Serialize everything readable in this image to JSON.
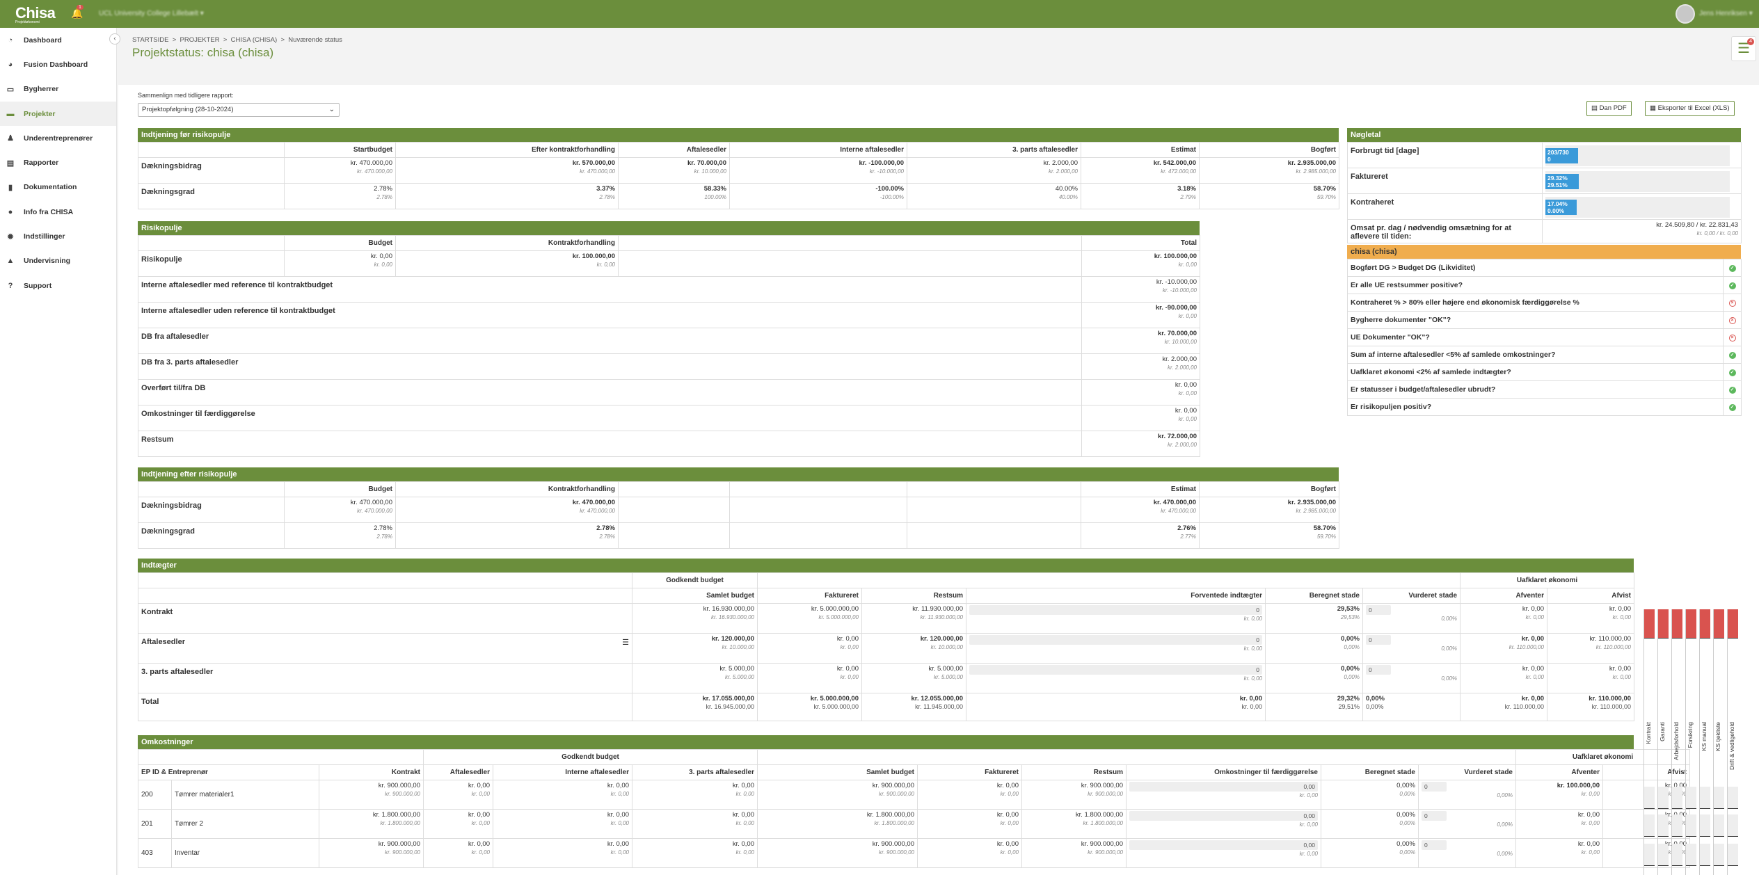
{
  "topbar": {
    "logo": "Chisa",
    "logo_sub": "Projektøkonomi",
    "bell_count": "1",
    "org_selector": "UCL University College Lillebælt ▾",
    "user_name": "Jens Henriksen ▾"
  },
  "sidebar": {
    "items": [
      {
        "label": "Dashboard",
        "icon": "speedometer-icon"
      },
      {
        "label": "Fusion Dashboard",
        "icon": "pie-icon"
      },
      {
        "label": "Bygherrer",
        "icon": "briefcase-icon"
      },
      {
        "label": "Projekter",
        "icon": "folder-icon",
        "active": true
      },
      {
        "label": "Underentreprenører",
        "icon": "user-icon"
      },
      {
        "label": "Rapporter",
        "icon": "document-icon"
      },
      {
        "label": "Dokumentation",
        "icon": "book-icon"
      },
      {
        "label": "Info fra CHISA",
        "icon": "info-icon"
      },
      {
        "label": "Indstillinger",
        "icon": "gear-icon"
      },
      {
        "label": "Undervisning",
        "icon": "graduation-icon"
      },
      {
        "label": "Support",
        "icon": "help-icon"
      }
    ]
  },
  "breadcrumb": {
    "items": [
      "STARTSIDE",
      "PROJEKTER",
      "CHISA (CHISA)",
      "Nuværende status"
    ]
  },
  "page_title": "Projektstatus: chisa (chisa)",
  "list_count": "4",
  "compare": {
    "label": "Sammenlign med tidligere rapport:",
    "selected": "Projektopfølgning (28-10-2024)"
  },
  "buttons": {
    "pdf": "Dan PDF",
    "excel": "Eksporter til Excel (XLS)"
  },
  "before": {
    "title": "Indtjening før risikopulje",
    "headers": [
      "",
      "Startbudget",
      "Efter kontraktforhandling",
      "Aftalesedler",
      "Interne aftalesedler",
      "3. parts aftalesedler",
      "Estimat",
      "Bogført"
    ],
    "rows": [
      {
        "label": "Dækningsbidrag",
        "cells": [
          [
            "kr. 470.000,00",
            "kr. 470.000,00"
          ],
          [
            "kr. 570.000,00",
            "kr. 470.000,00"
          ],
          [
            "kr. 70.000,00",
            "kr. 10.000,00"
          ],
          [
            "kr. -100.000,00",
            "kr. -10.000,00"
          ],
          [
            "kr. 2.000,00",
            "kr. 2.000,00"
          ],
          [
            "kr. 542.000,00",
            "kr. 472.000,00"
          ],
          [
            "kr. 2.935.000,00",
            "kr. 2.985.000,00"
          ]
        ]
      },
      {
        "label": "Dækningsgrad",
        "cells": [
          [
            "2.78%",
            "2.78%"
          ],
          [
            "3.37%",
            "2.78%"
          ],
          [
            "58.33%",
            "100.00%"
          ],
          [
            "-100.00%",
            "-100.00%"
          ],
          [
            "40.00%",
            "40.00%"
          ],
          [
            "3.18%",
            "2.79%"
          ],
          [
            "58.70%",
            "59.70%"
          ]
        ]
      }
    ]
  },
  "risk": {
    "title": "Risikopulje",
    "headers": [
      "",
      "Budget",
      "Kontraktforhandling",
      "",
      "Total"
    ],
    "first": {
      "label": "Risikopulje",
      "budget": [
        "kr. 0,00",
        "kr. 0,00"
      ],
      "kontrakt": [
        "kr. 100.000,00",
        "kr. 0,00"
      ],
      "total": [
        "kr. 100.000,00",
        "kr. 0,00"
      ]
    },
    "rows": [
      {
        "label": "Interne aftalesedler med reference til kontraktbudget",
        "total": [
          "kr. -10.000,00",
          "kr. -10.000,00"
        ]
      },
      {
        "label": "Interne aftalesedler uden reference til kontraktbudget",
        "total": [
          "kr. -90.000,00",
          "kr. 0,00"
        ]
      },
      {
        "label": "DB fra aftalesedler",
        "total": [
          "kr. 70.000,00",
          "kr. 10.000,00"
        ]
      },
      {
        "label": "DB fra 3. parts aftalesedler",
        "total": [
          "kr. 2.000,00",
          "kr. 2.000,00"
        ]
      },
      {
        "label": "Overført til/fra DB",
        "total": [
          "kr. 0,00",
          "kr. 0,00"
        ]
      },
      {
        "label": "Omkostninger til færdiggørelse",
        "total": [
          "kr. 0,00",
          "kr. 0,00"
        ]
      },
      {
        "label": "Restsum",
        "total": [
          "kr. 72.000,00",
          "kr. 2.000,00"
        ]
      }
    ]
  },
  "after": {
    "title": "Indtjening efter risikopulje",
    "headers": [
      "",
      "Budget",
      "Kontraktforhandling",
      "",
      "",
      "",
      "Estimat",
      "Bogført"
    ],
    "rows": [
      {
        "label": "Dækningsbidrag",
        "cells": [
          [
            "kr. 470.000,00",
            "kr. 470.000,00"
          ],
          [
            "kr. 470.000,00",
            "kr. 470.000,00"
          ],
          [
            "",
            ""
          ],
          [
            "",
            ""
          ],
          [
            "",
            ""
          ],
          [
            "kr. 470.000,00",
            "kr. 470.000,00"
          ],
          [
            "kr. 2.935.000,00",
            "kr. 2.985.000,00"
          ]
        ]
      },
      {
        "label": "Dækningsgrad",
        "cells": [
          [
            "2.78%",
            "2.78%"
          ],
          [
            "2.78%",
            "2.78%"
          ],
          [
            "",
            ""
          ],
          [
            "",
            ""
          ],
          [
            "",
            ""
          ],
          [
            "2.76%",
            "2.77%"
          ],
          [
            "58.70%",
            "59.70%"
          ]
        ]
      }
    ]
  },
  "kpi": {
    "title": "Nøgletal",
    "rows": [
      {
        "label": "Forbrugt tid [dage]",
        "bar_top": "203/730",
        "bar_bottom": "0",
        "fill": 0.177
      },
      {
        "label": "Faktureret",
        "bar_top": "29.32%",
        "bar_bottom": "29.51%",
        "fill": 0.18
      },
      {
        "label": "Kontraheret",
        "bar_top": "17.04%",
        "bar_bottom": "0.00%",
        "fill": 0.17
      }
    ],
    "omsat": {
      "label": "Omsat pr. dag / nødvendig omsætning for at aflevere til tiden:",
      "v1": "kr. 24.509,80 / kr. 22.831,43",
      "v2": "kr. 0,00 / kr. 0,00"
    }
  },
  "checks": {
    "title": "chisa (chisa)",
    "items": [
      {
        "label": "Bogført DG > Budget DG (Likviditet)",
        "ok": true
      },
      {
        "label": "Er alle UE restsummer positive?",
        "ok": true
      },
      {
        "label": "Kontraheret % > 80% eller højere end økonomisk færdiggørelse %",
        "ok": false
      },
      {
        "label": "Bygherre dokumenter \"OK\"?",
        "ok": false
      },
      {
        "label": "UE Dokumenter \"OK\"?",
        "ok": false
      },
      {
        "label": "Sum af interne aftalesedler <5% af samlede omkostninger?",
        "ok": true
      },
      {
        "label": "Uafklaret økonomi <2% af samlede indtægter?",
        "ok": true
      },
      {
        "label": "Er statusser i budget/aftalesedler ubrudt?",
        "ok": true
      },
      {
        "label": "Er risikopuljen positiv?",
        "ok": true
      }
    ]
  },
  "income": {
    "title": "Indtægter",
    "group1": "Godkendt budget",
    "group2": "Uafklaret økonomi",
    "headers": [
      "",
      "Samlet budget",
      "Faktureret",
      "Restsum",
      "Forventede indtægter",
      "Beregnet stade",
      "Vurderet stade",
      "Afventer",
      "Afvist"
    ],
    "rows": [
      {
        "label": "Kontrakt",
        "samlet": [
          "kr. 16.930.000,00",
          "kr. 16.930.000,00"
        ],
        "fakt": [
          "kr. 5.000.000,00",
          "kr. 5.000.000,00"
        ],
        "rest": [
          "kr. 11.930.000,00",
          "kr. 11.930.000,00"
        ],
        "forv": "0",
        "forv2": "kr. 0,00",
        "beregnet": [
          "29,53%",
          "29,53%"
        ],
        "vurderet": "0",
        "vurderet2": "0,00%",
        "afventer": [
          "kr. 0,00",
          "kr. 0,00"
        ],
        "afvist": [
          "kr. 0,00",
          "kr. 0,00"
        ]
      },
      {
        "label": "Aftalesedler",
        "samlet": [
          "kr. 120.000,00",
          "kr. 10.000,00"
        ],
        "fakt": [
          "kr. 0,00",
          "kr. 0,00"
        ],
        "rest": [
          "kr. 120.000,00",
          "kr. 10.000,00"
        ],
        "forv": "0",
        "forv2": "kr. 0,00",
        "beregnet": [
          "0,00%",
          "0,00%"
        ],
        "vurderet": "0",
        "vurderet2": "0,00%",
        "afventer": [
          "kr. 0,00",
          "kr. 110.000,00"
        ],
        "afvist": [
          "kr. 110.000,00",
          "kr. 110.000,00"
        ]
      },
      {
        "label": "3. parts aftalesedler",
        "samlet": [
          "kr. 5.000,00",
          "kr. 5.000,00"
        ],
        "fakt": [
          "kr. 0,00",
          "kr. 0,00"
        ],
        "rest": [
          "kr. 5.000,00",
          "kr. 5.000,00"
        ],
        "forv": "0",
        "forv2": "kr. 0,00",
        "beregnet": [
          "0,00%",
          "0,00%"
        ],
        "vurderet": "0",
        "vurderet2": "0,00%",
        "afventer": [
          "kr. 0,00",
          "kr. 0,00"
        ],
        "afvist": [
          "kr. 0,00",
          "kr. 0,00"
        ]
      }
    ],
    "total": {
      "label": "Total",
      "samlet": [
        "kr. 17.055.000,00",
        "kr. 16.945.000,00"
      ],
      "fakt": [
        "kr. 5.000.000,00",
        "kr. 5.000.000,00"
      ],
      "rest": [
        "kr. 12.055.000,00",
        "kr. 11.945.000,00"
      ],
      "forv": [
        "kr. 0,00",
        "kr. 0,00"
      ],
      "beregnet": [
        "29,32%",
        "29,51%"
      ],
      "vurderet": [
        "0,00%",
        "0,00%"
      ],
      "afventer": [
        "kr. 0,00",
        "kr. 110.000,00"
      ],
      "afvist": [
        "kr. 110.000,00",
        "kr. 110.000,00"
      ]
    }
  },
  "costs": {
    "title": "Omkostninger",
    "group1": "Godkendt budget",
    "group2": "Uafklaret økonomi",
    "headers": [
      "EP ID & Entreprenør",
      "Kontrakt",
      "Aftalesedler",
      "Interne aftalesedler",
      "3. parts aftalesedler",
      "Samlet budget",
      "Faktureret",
      "Restsum",
      "Omkostninger til færdiggørelse",
      "Beregnet stade",
      "Vurderet stade",
      "Afventer",
      "Afvist"
    ],
    "rows": [
      {
        "id": "200",
        "name": "Tømrer materialer1",
        "kontrakt": [
          "kr. 900.000,00",
          "kr. 900.000,00"
        ],
        "samlet": [
          "kr. 900.000,00",
          "kr. 900.000,00"
        ],
        "rest": [
          "kr. 900.000,00",
          "kr. 900.000,00"
        ],
        "afventer": [
          "kr. 100.000,00",
          "kr. 0,00"
        ]
      },
      {
        "id": "201",
        "name": "Tømrer 2",
        "kontrakt": [
          "kr. 1.800.000,00",
          "kr. 1.800.000,00"
        ],
        "samlet": [
          "kr. 1.800.000,00",
          "kr. 1.800.000,00"
        ],
        "rest": [
          "kr. 1.800.000,00",
          "kr. 1.800.000,00"
        ],
        "afventer": [
          "kr. 0,00",
          "kr. 0,00"
        ]
      },
      {
        "id": "403",
        "name": "Inventar",
        "kontrakt": [
          "kr. 900.000,00",
          "kr. 900.000,00"
        ],
        "samlet": [
          "kr. 900.000,00",
          "kr. 900.000,00"
        ],
        "rest": [
          "kr. 900.000,00",
          "kr. 900.000,00"
        ],
        "afventer": [
          "kr. 0,00",
          "kr. 0,00"
        ]
      }
    ],
    "zero": [
      "kr. 0,00",
      "kr. 0,00"
    ],
    "zero_pct": [
      "0,00%",
      "0,00%"
    ],
    "zero_box": "0,00",
    "vurderet_box": "0",
    "vurderet_pct": "0,00%"
  },
  "doc_columns": [
    "Kontrakt",
    "Garanti",
    "Arbejdsforhold",
    "Forsikring",
    "KS manual",
    "KS tjekliste",
    "Drift & vedligehold"
  ],
  "colors": {
    "brand": "#6b8e3c",
    "warning": "#f0ad4e",
    "danger": "#d9534f",
    "bar": "#3a9ad9"
  }
}
